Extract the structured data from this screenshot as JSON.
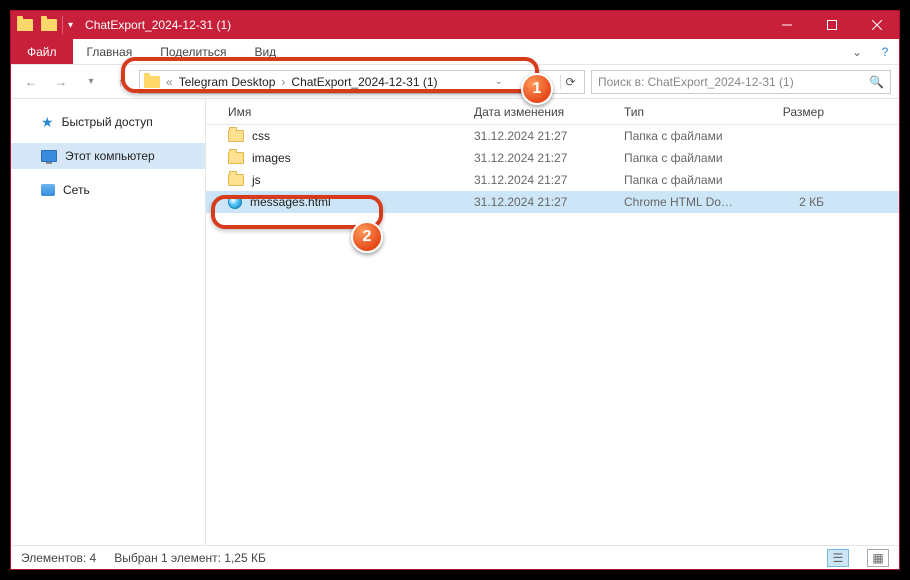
{
  "window": {
    "title": "ChatExport_2024-12-31 (1)"
  },
  "menubar": {
    "file": "Файл",
    "tabs": [
      "Главная",
      "Поделиться",
      "Вид"
    ]
  },
  "address": {
    "back_chevrons": "«",
    "crumbs": [
      "Telegram Desktop",
      "ChatExport_2024-12-31 (1)"
    ]
  },
  "search": {
    "placeholder": "Поиск в: ChatExport_2024-12-31 (1)"
  },
  "sidebar": {
    "quick_access": "Быстрый доступ",
    "this_pc": "Этот компьютер",
    "network": "Сеть"
  },
  "columns": {
    "name": "Имя",
    "date": "Дата изменения",
    "type": "Тип",
    "size": "Размер"
  },
  "rows": [
    {
      "icon": "folder",
      "name": "css",
      "date": "31.12.2024 21:27",
      "type": "Папка с файлами",
      "size": "",
      "selected": false
    },
    {
      "icon": "folder",
      "name": "images",
      "date": "31.12.2024 21:27",
      "type": "Папка с файлами",
      "size": "",
      "selected": false
    },
    {
      "icon": "folder",
      "name": "js",
      "date": "31.12.2024 21:27",
      "type": "Папка с файлами",
      "size": "",
      "selected": false
    },
    {
      "icon": "html",
      "name": "messages.html",
      "date": "31.12.2024 21:27",
      "type": "Chrome HTML Do…",
      "size": "2 КБ",
      "selected": true
    }
  ],
  "statusbar": {
    "elements": "Элементов: 4",
    "selected": "Выбран 1 элемент: 1,25 КБ"
  },
  "callouts": {
    "badge1": "1",
    "badge2": "2"
  }
}
